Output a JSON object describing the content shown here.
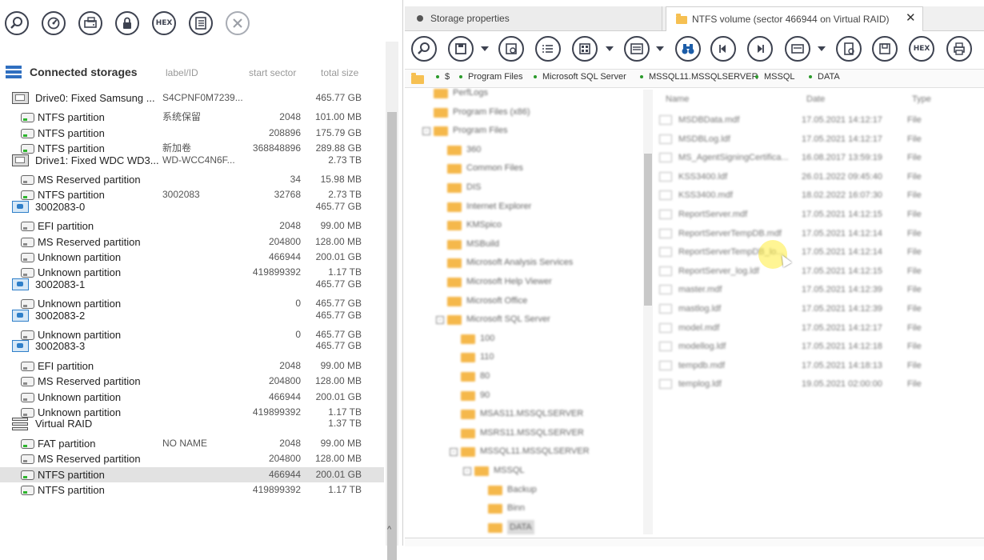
{
  "left": {
    "toolbar": [
      {
        "name": "search-button",
        "icon": "magnifier-icon"
      },
      {
        "name": "scan-button",
        "icon": "scan-gauge-icon"
      },
      {
        "name": "image-button",
        "icon": "drive-image-icon"
      },
      {
        "name": "lock-button",
        "icon": "lock-icon"
      },
      {
        "name": "hex-button",
        "icon": "hex-icon",
        "label": "HEX"
      },
      {
        "name": "list-button",
        "icon": "list-icon"
      },
      {
        "name": "close-storage-button",
        "icon": "close-icon"
      }
    ],
    "header": {
      "title": "Connected storages",
      "col_label": "label/ID",
      "col_sector": "start sector",
      "col_size": "total size"
    },
    "rows": [
      {
        "type": "disk",
        "indent": 0,
        "name": "Drive0: Fixed Samsung ...",
        "label": "S4CPNF0M7239...",
        "sector": "",
        "size": "465.77 GB"
      },
      {
        "type": "ntfs",
        "indent": 1,
        "name": "NTFS partition",
        "label": "系统保留",
        "sector": "2048",
        "size": "101.00 MB"
      },
      {
        "type": "ntfs",
        "indent": 1,
        "name": "NTFS partition",
        "label": "",
        "sector": "208896",
        "size": "175.79 GB"
      },
      {
        "type": "ntfs",
        "indent": 1,
        "name": "NTFS partition",
        "label": "新加卷",
        "sector": "368848896",
        "size": "289.88 GB"
      },
      {
        "type": "disk",
        "indent": 0,
        "name": "Drive1: Fixed WDC WD3...",
        "label": "WD-WCC4N6F...",
        "sector": "",
        "size": "2.73 TB"
      },
      {
        "type": "part",
        "indent": 1,
        "name": "MS Reserved partition",
        "label": "",
        "sector": "34",
        "size": "15.98 MB"
      },
      {
        "type": "ntfs",
        "indent": 1,
        "name": "NTFS partition",
        "label": "3002083",
        "sector": "32768",
        "size": "2.73 TB"
      },
      {
        "type": "virt",
        "indent": 0,
        "name": "3002083-0",
        "label": "",
        "sector": "",
        "size": "465.77 GB"
      },
      {
        "type": "part",
        "indent": 1,
        "name": "EFI partition",
        "label": "",
        "sector": "2048",
        "size": "99.00 MB"
      },
      {
        "type": "part",
        "indent": 1,
        "name": "MS Reserved partition",
        "label": "",
        "sector": "204800",
        "size": "128.00 MB"
      },
      {
        "type": "part",
        "indent": 1,
        "name": "Unknown partition",
        "label": "",
        "sector": "466944",
        "size": "200.01 GB"
      },
      {
        "type": "part",
        "indent": 1,
        "name": "Unknown partition",
        "label": "",
        "sector": "419899392",
        "size": "1.17 TB"
      },
      {
        "type": "virt",
        "indent": 0,
        "name": "3002083-1",
        "label": "",
        "sector": "",
        "size": "465.77 GB"
      },
      {
        "type": "part",
        "indent": 1,
        "name": "Unknown partition",
        "label": "",
        "sector": "0",
        "size": "465.77 GB"
      },
      {
        "type": "virt",
        "indent": 0,
        "name": "3002083-2",
        "label": "",
        "sector": "",
        "size": "465.77 GB"
      },
      {
        "type": "part",
        "indent": 1,
        "name": "Unknown partition",
        "label": "",
        "sector": "0",
        "size": "465.77 GB"
      },
      {
        "type": "virt",
        "indent": 0,
        "name": "3002083-3",
        "label": "",
        "sector": "",
        "size": "465.77 GB"
      },
      {
        "type": "part",
        "indent": 1,
        "name": "EFI partition",
        "label": "",
        "sector": "2048",
        "size": "99.00 MB"
      },
      {
        "type": "part",
        "indent": 1,
        "name": "MS Reserved partition",
        "label": "",
        "sector": "204800",
        "size": "128.00 MB"
      },
      {
        "type": "part",
        "indent": 1,
        "name": "Unknown partition",
        "label": "",
        "sector": "466944",
        "size": "200.01 GB"
      },
      {
        "type": "part",
        "indent": 1,
        "name": "Unknown partition",
        "label": "",
        "sector": "419899392",
        "size": "1.17 TB"
      },
      {
        "type": "raid",
        "indent": 0,
        "name": "Virtual RAID",
        "label": "",
        "sector": "",
        "size": "1.37 TB"
      },
      {
        "type": "fat",
        "indent": 1,
        "name": "FAT partition",
        "label": "NO NAME",
        "sector": "2048",
        "size": "99.00 MB"
      },
      {
        "type": "part",
        "indent": 1,
        "name": "MS Reserved partition",
        "label": "",
        "sector": "204800",
        "size": "128.00 MB"
      },
      {
        "type": "ntfs",
        "indent": 1,
        "name": "NTFS partition",
        "label": "",
        "sector": "466944",
        "size": "200.01 GB",
        "selected": true
      },
      {
        "type": "ntfs",
        "indent": 1,
        "name": "NTFS partition",
        "label": "",
        "sector": "419899392",
        "size": "1.17 TB"
      }
    ]
  },
  "right": {
    "tabs": [
      {
        "label": "Storage properties",
        "active": false
      },
      {
        "label": "NTFS volume (sector 466944 on Virtual RAID)",
        "active": true
      }
    ],
    "tab_close": "✕",
    "toolbar": [
      "search",
      "save",
      "save-files",
      "list",
      "view-mode",
      "panel-layout",
      "find-binoculars",
      "prev",
      "next",
      "file-preview",
      "properties",
      "save-image",
      "hex",
      "print"
    ],
    "breadcrumb": [
      "$",
      "Program Files",
      "Microsoft SQL Server",
      "MSSQL11.MSSQLSERVER",
      "MSSQL",
      "DATA"
    ],
    "folder_tree": [
      {
        "name": "PerfLogs",
        "depth": 1,
        "pm": ""
      },
      {
        "name": "Program Files (x86)",
        "depth": 1,
        "pm": ""
      },
      {
        "name": "Program Files",
        "depth": 1,
        "pm": "-"
      },
      {
        "name": "360",
        "depth": 2,
        "pm": ""
      },
      {
        "name": "Common Files",
        "depth": 2,
        "pm": ""
      },
      {
        "name": "DIS",
        "depth": 2,
        "pm": ""
      },
      {
        "name": "Internet Explorer",
        "depth": 2,
        "pm": ""
      },
      {
        "name": "KMSpico",
        "depth": 2,
        "pm": ""
      },
      {
        "name": "MSBuild",
        "depth": 2,
        "pm": ""
      },
      {
        "name": "Microsoft Analysis Services",
        "depth": 2,
        "pm": ""
      },
      {
        "name": "Microsoft Help Viewer",
        "depth": 2,
        "pm": ""
      },
      {
        "name": "Microsoft Office",
        "depth": 2,
        "pm": ""
      },
      {
        "name": "Microsoft SQL Server",
        "depth": 2,
        "pm": "-"
      },
      {
        "name": "100",
        "depth": 3,
        "pm": ""
      },
      {
        "name": "110",
        "depth": 3,
        "pm": ""
      },
      {
        "name": "80",
        "depth": 3,
        "pm": ""
      },
      {
        "name": "90",
        "depth": 3,
        "pm": ""
      },
      {
        "name": "MSAS11.MSSQLSERVER",
        "depth": 3,
        "pm": ""
      },
      {
        "name": "MSRS11.MSSQLSERVER",
        "depth": 3,
        "pm": ""
      },
      {
        "name": "MSSQL11.MSSQLSERVER",
        "depth": 3,
        "pm": "-"
      },
      {
        "name": "MSSQL",
        "depth": 4,
        "pm": "-"
      },
      {
        "name": "Backup",
        "depth": 5,
        "pm": ""
      },
      {
        "name": "Binn",
        "depth": 5,
        "pm": ""
      },
      {
        "name": "DATA",
        "depth": 5,
        "pm": "",
        "selected": true
      }
    ],
    "file_columns": {
      "name": "Name",
      "date": "Date",
      "type": "Type"
    },
    "files": [
      {
        "name": "MSDBData.mdf",
        "date": "17.05.2021 14:12:17",
        "type": "File"
      },
      {
        "name": "MSDBLog.ldf",
        "date": "17.05.2021 14:12:17",
        "type": "File"
      },
      {
        "name": "MS_AgentSigningCertifica...",
        "date": "16.08.2017 13:59:19",
        "type": "File"
      },
      {
        "name": "KSS3400.ldf",
        "date": "26.01.2022 09:45:40",
        "type": "File"
      },
      {
        "name": "KSS3400.mdf",
        "date": "18.02.2022 16:07:30",
        "type": "File"
      },
      {
        "name": "ReportServer.mdf",
        "date": "17.05.2021 14:12:15",
        "type": "File"
      },
      {
        "name": "ReportServerTempDB.mdf",
        "date": "17.05.2021 14:12:14",
        "type": "File"
      },
      {
        "name": "ReportServerTempDB_lo...",
        "date": "17.05.2021 14:12:14",
        "type": "File"
      },
      {
        "name": "ReportServer_log.ldf",
        "date": "17.05.2021 14:12:15",
        "type": "File"
      },
      {
        "name": "master.mdf",
        "date": "17.05.2021 14:12:39",
        "type": "File"
      },
      {
        "name": "mastlog.ldf",
        "date": "17.05.2021 14:12:39",
        "type": "File"
      },
      {
        "name": "model.mdf",
        "date": "17.05.2021 14:12:17",
        "type": "File"
      },
      {
        "name": "modellog.ldf",
        "date": "17.05.2021 14:12:18",
        "type": "File"
      },
      {
        "name": "tempdb.mdf",
        "date": "17.05.2021 14:18:13",
        "type": "File"
      },
      {
        "name": "templog.ldf",
        "date": "19.05.2021 02:00:00",
        "type": "File"
      }
    ]
  }
}
